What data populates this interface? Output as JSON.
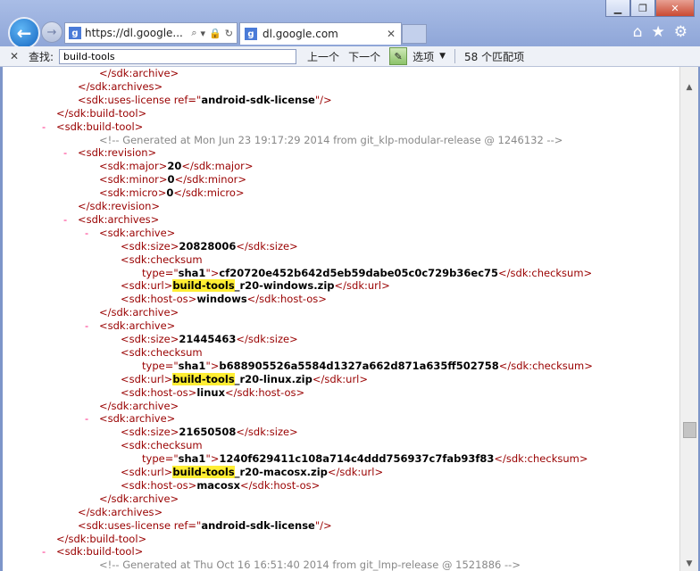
{
  "window": {
    "minimize": "▁",
    "maximize": "❐",
    "close": "✕"
  },
  "nav": {
    "address_url": "https://dl.google...",
    "tab_title": "dl.google.com",
    "tab_close": "✕"
  },
  "find": {
    "close": "✕",
    "label": "查找:",
    "value": "build-tools",
    "prev": "上一个",
    "next": "下一个",
    "options": "选项",
    "options_arrow": "▼",
    "matches": "58 个匹配项"
  },
  "lines": [
    {
      "indent": 108,
      "dash": false,
      "parts": [
        {
          "c": "tg",
          "t": "</sdk:archive>"
        }
      ]
    },
    {
      "indent": 84,
      "dash": false,
      "parts": [
        {
          "c": "tg",
          "t": "</sdk:archives>"
        }
      ]
    },
    {
      "indent": 84,
      "dash": false,
      "parts": [
        {
          "c": "tg",
          "t": "<sdk:uses-license "
        },
        {
          "c": "at",
          "t": "ref"
        },
        {
          "c": "tg",
          "t": "=\""
        },
        {
          "c": "av",
          "t": "android-sdk-license"
        },
        {
          "c": "tg",
          "t": "\"/>"
        }
      ]
    },
    {
      "indent": 60,
      "dash": false,
      "parts": [
        {
          "c": "tg",
          "t": "</sdk:build-tool>"
        }
      ]
    },
    {
      "indent": 60,
      "dash": true,
      "parts": [
        {
          "c": "tg",
          "t": "<sdk:build-tool>"
        }
      ]
    },
    {
      "indent": 108,
      "dash": false,
      "parts": [
        {
          "c": "cm",
          "t": "<!-- Generated at Mon Jun 23 19:17:29 2014 from git_klp-modular-release @ 1246132 -->"
        }
      ]
    },
    {
      "indent": 84,
      "dash": true,
      "parts": [
        {
          "c": "tg",
          "t": "<sdk:revision>"
        }
      ]
    },
    {
      "indent": 108,
      "dash": false,
      "parts": [
        {
          "c": "tg",
          "t": "<sdk:major>"
        },
        {
          "c": "tx",
          "t": "20"
        },
        {
          "c": "tg",
          "t": "</sdk:major>"
        }
      ]
    },
    {
      "indent": 108,
      "dash": false,
      "parts": [
        {
          "c": "tg",
          "t": "<sdk:minor>"
        },
        {
          "c": "tx",
          "t": "0"
        },
        {
          "c": "tg",
          "t": "</sdk:minor>"
        }
      ]
    },
    {
      "indent": 108,
      "dash": false,
      "parts": [
        {
          "c": "tg",
          "t": "<sdk:micro>"
        },
        {
          "c": "tx",
          "t": "0"
        },
        {
          "c": "tg",
          "t": "</sdk:micro>"
        }
      ]
    },
    {
      "indent": 84,
      "dash": false,
      "parts": [
        {
          "c": "tg",
          "t": "</sdk:revision>"
        }
      ]
    },
    {
      "indent": 84,
      "dash": true,
      "parts": [
        {
          "c": "tg",
          "t": "<sdk:archives>"
        }
      ]
    },
    {
      "indent": 108,
      "dash": true,
      "parts": [
        {
          "c": "tg",
          "t": "<sdk:archive>"
        }
      ]
    },
    {
      "indent": 132,
      "dash": false,
      "parts": [
        {
          "c": "tg",
          "t": "<sdk:size>"
        },
        {
          "c": "tx",
          "t": "20828006"
        },
        {
          "c": "tg",
          "t": "</sdk:size>"
        }
      ]
    },
    {
      "indent": 132,
      "dash": false,
      "parts": [
        {
          "c": "tg",
          "t": "<sdk:checksum"
        }
      ]
    },
    {
      "indent": 156,
      "dash": false,
      "parts": [
        {
          "c": "at",
          "t": "type"
        },
        {
          "c": "tg",
          "t": "=\""
        },
        {
          "c": "av",
          "t": "sha1"
        },
        {
          "c": "tg",
          "t": "\">"
        },
        {
          "c": "tx",
          "t": "cf20720e452b642d5eb59dabe05c0c729b36ec75"
        },
        {
          "c": "tg",
          "t": "</sdk:checksum>"
        }
      ]
    },
    {
      "indent": 132,
      "dash": false,
      "parts": [
        {
          "c": "tg",
          "t": "<sdk:url>"
        },
        {
          "c": "hl",
          "t": "build-tools"
        },
        {
          "c": "tx",
          "t": "_r20-windows.zip"
        },
        {
          "c": "tg",
          "t": "</sdk:url>"
        }
      ]
    },
    {
      "indent": 132,
      "dash": false,
      "parts": [
        {
          "c": "tg",
          "t": "<sdk:host-os>"
        },
        {
          "c": "tx",
          "t": "windows"
        },
        {
          "c": "tg",
          "t": "</sdk:host-os>"
        }
      ]
    },
    {
      "indent": 108,
      "dash": false,
      "parts": [
        {
          "c": "tg",
          "t": "</sdk:archive>"
        }
      ]
    },
    {
      "indent": 108,
      "dash": true,
      "parts": [
        {
          "c": "tg",
          "t": "<sdk:archive>"
        }
      ]
    },
    {
      "indent": 132,
      "dash": false,
      "parts": [
        {
          "c": "tg",
          "t": "<sdk:size>"
        },
        {
          "c": "tx",
          "t": "21445463"
        },
        {
          "c": "tg",
          "t": "</sdk:size>"
        }
      ]
    },
    {
      "indent": 132,
      "dash": false,
      "parts": [
        {
          "c": "tg",
          "t": "<sdk:checksum"
        }
      ]
    },
    {
      "indent": 156,
      "dash": false,
      "parts": [
        {
          "c": "at",
          "t": "type"
        },
        {
          "c": "tg",
          "t": "=\""
        },
        {
          "c": "av",
          "t": "sha1"
        },
        {
          "c": "tg",
          "t": "\">"
        },
        {
          "c": "tx",
          "t": "b688905526a5584d1327a662d871a635ff502758"
        },
        {
          "c": "tg",
          "t": "</sdk:checksum>"
        }
      ]
    },
    {
      "indent": 132,
      "dash": false,
      "parts": [
        {
          "c": "tg",
          "t": "<sdk:url>"
        },
        {
          "c": "hl",
          "t": "build-tools"
        },
        {
          "c": "tx",
          "t": "_r20-linux.zip"
        },
        {
          "c": "tg",
          "t": "</sdk:url>"
        }
      ]
    },
    {
      "indent": 132,
      "dash": false,
      "parts": [
        {
          "c": "tg",
          "t": "<sdk:host-os>"
        },
        {
          "c": "tx",
          "t": "linux"
        },
        {
          "c": "tg",
          "t": "</sdk:host-os>"
        }
      ]
    },
    {
      "indent": 108,
      "dash": false,
      "parts": [
        {
          "c": "tg",
          "t": "</sdk:archive>"
        }
      ]
    },
    {
      "indent": 108,
      "dash": true,
      "parts": [
        {
          "c": "tg",
          "t": "<sdk:archive>"
        }
      ]
    },
    {
      "indent": 132,
      "dash": false,
      "parts": [
        {
          "c": "tg",
          "t": "<sdk:size>"
        },
        {
          "c": "tx",
          "t": "21650508"
        },
        {
          "c": "tg",
          "t": "</sdk:size>"
        }
      ]
    },
    {
      "indent": 132,
      "dash": false,
      "parts": [
        {
          "c": "tg",
          "t": "<sdk:checksum"
        }
      ]
    },
    {
      "indent": 156,
      "dash": false,
      "parts": [
        {
          "c": "at",
          "t": "type"
        },
        {
          "c": "tg",
          "t": "=\""
        },
        {
          "c": "av",
          "t": "sha1"
        },
        {
          "c": "tg",
          "t": "\">"
        },
        {
          "c": "tx",
          "t": "1240f629411c108a714c4ddd756937c7fab93f83"
        },
        {
          "c": "tg",
          "t": "</sdk:checksum>"
        }
      ]
    },
    {
      "indent": 132,
      "dash": false,
      "parts": [
        {
          "c": "tg",
          "t": "<sdk:url>"
        },
        {
          "c": "hl",
          "t": "build-tools"
        },
        {
          "c": "tx",
          "t": "_r20-macosx.zip"
        },
        {
          "c": "tg",
          "t": "</sdk:url>"
        }
      ]
    },
    {
      "indent": 132,
      "dash": false,
      "parts": [
        {
          "c": "tg",
          "t": "<sdk:host-os>"
        },
        {
          "c": "tx",
          "t": "macosx"
        },
        {
          "c": "tg",
          "t": "</sdk:host-os>"
        }
      ]
    },
    {
      "indent": 108,
      "dash": false,
      "parts": [
        {
          "c": "tg",
          "t": "</sdk:archive>"
        }
      ]
    },
    {
      "indent": 84,
      "dash": false,
      "parts": [
        {
          "c": "tg",
          "t": "</sdk:archives>"
        }
      ]
    },
    {
      "indent": 84,
      "dash": false,
      "parts": [
        {
          "c": "tg",
          "t": "<sdk:uses-license "
        },
        {
          "c": "at",
          "t": "ref"
        },
        {
          "c": "tg",
          "t": "=\""
        },
        {
          "c": "av",
          "t": "android-sdk-license"
        },
        {
          "c": "tg",
          "t": "\"/>"
        }
      ]
    },
    {
      "indent": 60,
      "dash": false,
      "parts": [
        {
          "c": "tg",
          "t": "</sdk:build-tool>"
        }
      ]
    },
    {
      "indent": 60,
      "dash": true,
      "parts": [
        {
          "c": "tg",
          "t": "<sdk:build-tool>"
        }
      ]
    },
    {
      "indent": 108,
      "dash": false,
      "parts": [
        {
          "c": "cm",
          "t": "<!-- Generated at Thu Oct 16 16:51:40 2014 from git_lmp-release @ 1521886 -->"
        }
      ]
    }
  ]
}
